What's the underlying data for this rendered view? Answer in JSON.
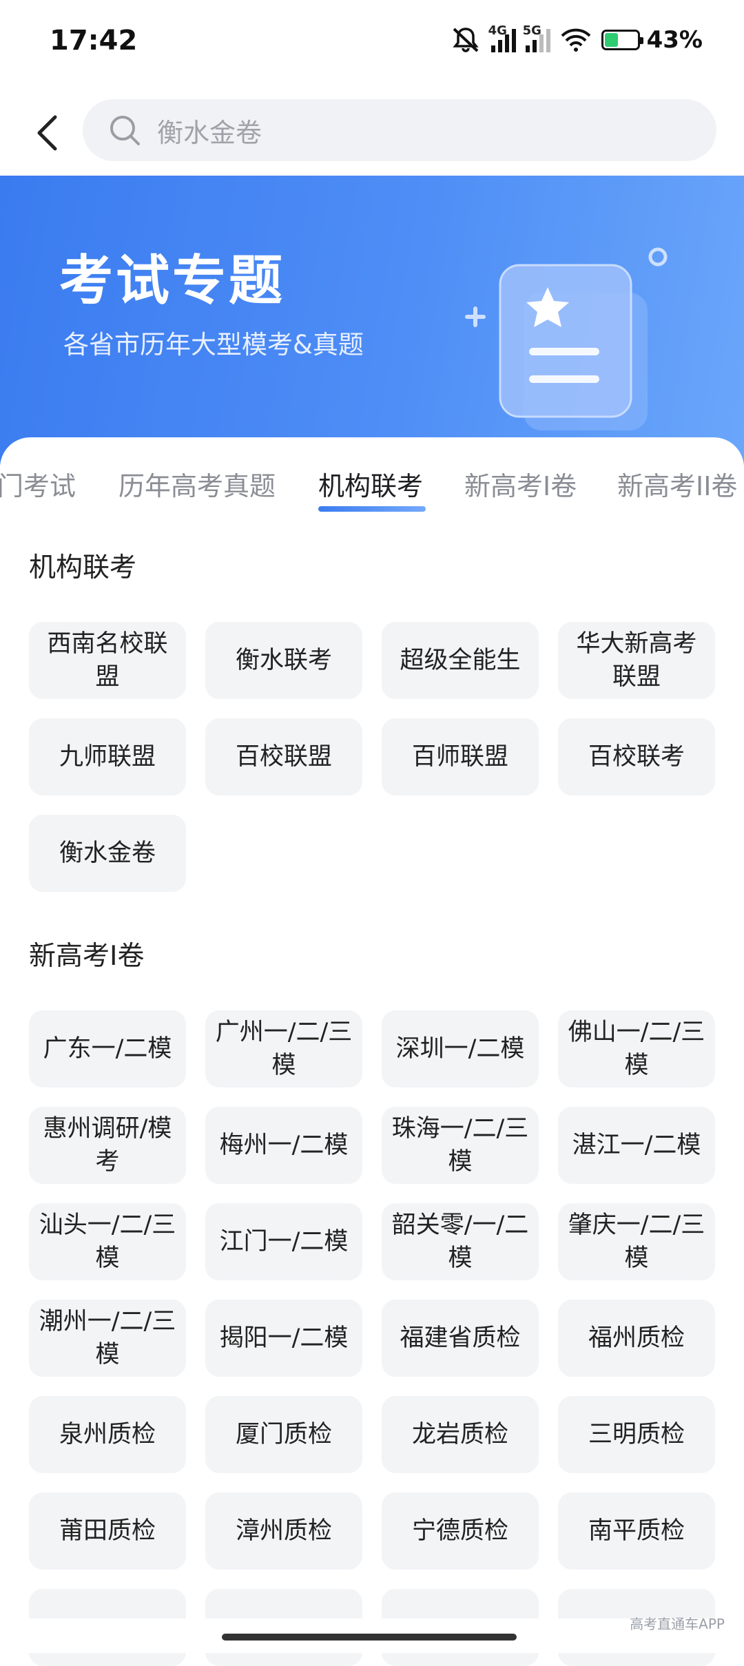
{
  "status_bar": {
    "time": "17:42",
    "signal1": "4G",
    "signal2": "5G",
    "battery": "43%"
  },
  "search": {
    "placeholder": "衡水金卷"
  },
  "banner": {
    "title": "考试专题",
    "subtitle": "各省市历年大型模考&真题"
  },
  "tabs": [
    {
      "label": "门考试",
      "active": false
    },
    {
      "label": "历年高考真题",
      "active": false
    },
    {
      "label": "机构联考",
      "active": true
    },
    {
      "label": "新高考I卷",
      "active": false
    },
    {
      "label": "新高考II卷",
      "active": false
    }
  ],
  "sections": [
    {
      "title": "机构联考",
      "items": [
        "西南名校联盟",
        "衡水联考",
        "超级全能生",
        "华大新高考联盟",
        "九师联盟",
        "百校联盟",
        "百师联盟",
        "百校联考",
        "衡水金卷"
      ]
    },
    {
      "title": "新高考I卷",
      "items": [
        "广东一/二模",
        "广州一/二/三模",
        "深圳一/二模",
        "佛山一/二/三模",
        "惠州调研/模考",
        "梅州一/二模",
        "珠海一/二/三模",
        "湛江一/二模",
        "汕头一/二/三模",
        "江门一/二模",
        "韶关零/一/二模",
        "肇庆一/二/三模",
        "潮州一/二/三模",
        "揭阳一/二模",
        "福建省质检",
        "福州质检",
        "泉州质检",
        "厦门质检",
        "龙岩质检",
        "三明质检",
        "莆田质检",
        "漳州质检",
        "宁德质检",
        "南平质检"
      ]
    }
  ],
  "watermark": "高考直通车APP",
  "colors": {
    "accent": "#3b7cf0",
    "chip_bg": "#f3f4f6"
  }
}
